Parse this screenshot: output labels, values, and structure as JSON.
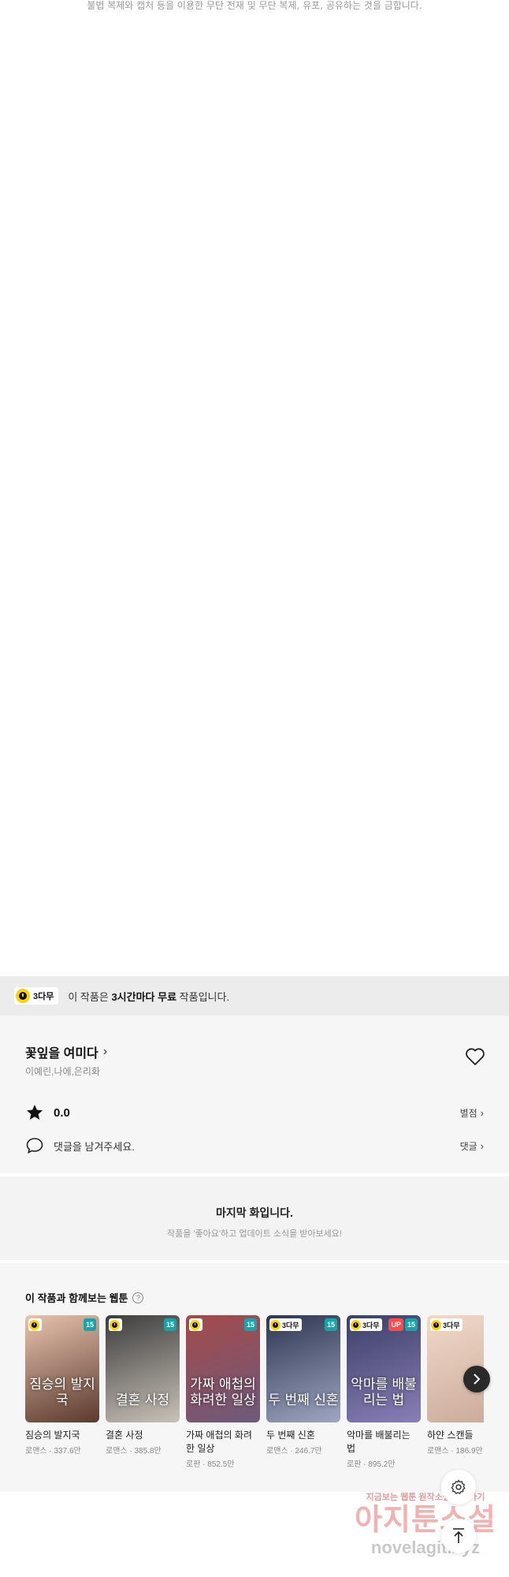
{
  "notice": "불법 복제와 캡처 등을 이용한 무단 전재 및 무단 복제, 유포, 공유하는 것을 금합니다.",
  "free_bar": {
    "badge": "3다무",
    "text_prefix": "이 작품은 ",
    "text_bold": "3시간마다 무료",
    "text_suffix": " 작품입니다."
  },
  "work": {
    "title": "꽃잎을 여미다",
    "authors": "이예린,나에,은리화",
    "rating": "0.0",
    "rating_link": "별점",
    "comment_placeholder": "댓글을 남겨주세요.",
    "comment_link": "댓글"
  },
  "last_episode": {
    "title": "마지막 화입니다.",
    "subtitle": "작품을 '좋아요'하고 업데이트 소식을 받아보세요!"
  },
  "recommend": {
    "heading": "이 작품과 함께보는 웹툰",
    "help": "?",
    "cards": [
      {
        "title": "짐승의 발지국",
        "art": "짐승의 발지국",
        "meta": "로맨스 · 337.6만",
        "badge": "",
        "age": "15",
        "up": "",
        "color1": "#e8c3ae",
        "color2": "#5a3a2e"
      },
      {
        "title": "결혼 사정",
        "art": "결혼 사정",
        "meta": "로맨스 · 385.8만",
        "badge": "",
        "age": "15",
        "up": "",
        "color1": "#3c3c3c",
        "color2": "#c9c2b8"
      },
      {
        "title": "가짜 애첩의 화려한 일상",
        "art": "가짜 애첩의 화려한 일상",
        "meta": "로판 · 852.5만",
        "badge": "",
        "age": "15",
        "up": "",
        "color1": "#a44a4a",
        "color2": "#6e5a7c"
      },
      {
        "title": "두 번째 신혼",
        "art": "두 번째 신혼",
        "meta": "로맨스 · 246.7만",
        "badge": "3다무",
        "age": "15",
        "up": "",
        "color1": "#2e3550",
        "color2": "#9ea6c2"
      },
      {
        "title": "악마를 배불리는 법",
        "art": "악마를 배불리는 법",
        "meta": "로판 · 895.2만",
        "badge": "3다무",
        "age": "15",
        "up": "UP",
        "color1": "#3b3f66",
        "color2": "#8a7fb8"
      },
      {
        "title": "하얀 스캔들",
        "art": "",
        "meta": "로맨스 · 186.9만",
        "badge": "3다무",
        "age": "",
        "up": "",
        "color1": "#f1d9c9",
        "color2": "#caa99a"
      }
    ]
  },
  "watermark": {
    "top": "지금보는 웹툰 원작소설 보러가기",
    "main": "아지툰소설",
    "url": "novelagit.xyz"
  },
  "colors": {
    "accent_yellow": "#ffd400",
    "age_teal": "#1aa3a7",
    "up_red": "#ff4a4a"
  }
}
